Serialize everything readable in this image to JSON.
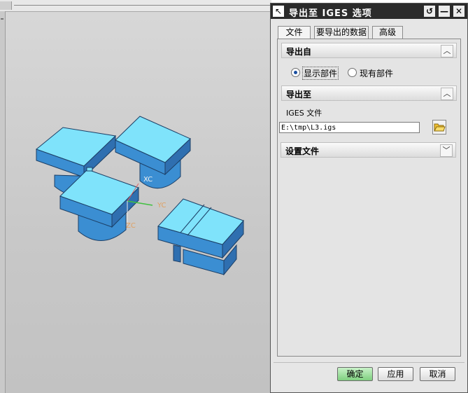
{
  "dialog": {
    "title": "导出至 IGES 选项",
    "tabs": [
      {
        "label": "文件",
        "active": true
      },
      {
        "label": "要导出的数据",
        "active": false
      },
      {
        "label": "高级",
        "active": false
      }
    ],
    "export_from": {
      "header": "导出自",
      "options": [
        {
          "label": "显示部件",
          "selected": true
        },
        {
          "label": "现有部件",
          "selected": false
        }
      ]
    },
    "export_to": {
      "header": "导出至",
      "file_label": "IGES 文件",
      "file_value": "E:\\tmp\\L3.igs"
    },
    "settings": {
      "header": "设置文件"
    },
    "buttons": {
      "ok": "确定",
      "apply": "应用",
      "cancel": "取消"
    }
  },
  "viewport": {
    "axis_labels": {
      "x": "XC",
      "y": "YC",
      "z": "ZC"
    },
    "colors": {
      "block_top": "#7fe3fb",
      "block_side": "#3b8ed2",
      "block_dark": "#2f6fb0",
      "axis_x": "#e06060",
      "axis_y": "#40c040",
      "axis_z": "#e0a060"
    }
  },
  "icons": {
    "title_icon": "select-arrow-icon",
    "reset": "reset-icon",
    "minimize": "minimize-icon",
    "close": "close-icon",
    "browse": "folder-open-icon"
  }
}
